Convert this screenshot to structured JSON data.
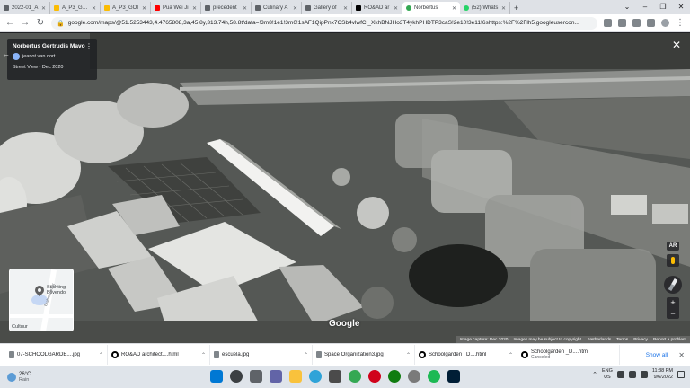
{
  "browser": {
    "tabs": [
      {
        "label": "2022-01_A",
        "active": false
      },
      {
        "label": "A_P3_GAR",
        "active": false
      },
      {
        "label": "A_P3_GOI",
        "active": false
      },
      {
        "label": "Pua Wei Ji",
        "active": false
      },
      {
        "label": "precedent",
        "active": false
      },
      {
        "label": "Culinary A",
        "active": false
      },
      {
        "label": "Gallery of",
        "active": false
      },
      {
        "label": "RO&AD ar",
        "active": false
      },
      {
        "label": "Norbertus",
        "active": true
      },
      {
        "label": "(52) Whats",
        "active": false
      }
    ],
    "new_tab": "+",
    "url": "google.com/maps/@51.5253443,4.4765808,3a,45.8y,313.74h,58.8t/data=!3m8!1e1!3m6!1sAF1QipPnx7CSb4vlwfCI_XkhBNJHo3T4ykhPHDTP3caS!2e10!3e11!6shttps:%2F%2Flh5.googleusercon..."
  },
  "street_view": {
    "place_title": "Norbertus Gertrudis Mavo",
    "author": "jeanot van dort",
    "date": "Street View - Dec 2020",
    "ar_label": "AR",
    "zoom_in": "+",
    "zoom_out": "−",
    "watermark": "Google",
    "footer": {
      "capture": "Image capture: Dec 2020",
      "copyright": "Images may be subject to copyright.",
      "netherlands": "Netherlands",
      "terms": "Terms",
      "privacy": "Privacy",
      "report": "Report a problem"
    }
  },
  "minimap": {
    "place_line1": "Stichting",
    "place_line2": "Blivendo",
    "street": "Brahmsstraat",
    "area": "Cultuur"
  },
  "downloads": {
    "items": [
      {
        "name": "07-SCHOOLGARDE....jpg",
        "status": "",
        "icon": "file"
      },
      {
        "name": "RO&AD architect....html",
        "status": "",
        "icon": "opera"
      },
      {
        "name": "escuela.jpg",
        "status": "",
        "icon": "file"
      },
      {
        "name": "Space Organization3.jpg",
        "status": "",
        "icon": "file"
      },
      {
        "name": "Schoolgarden _D....html",
        "status": "",
        "icon": "opera"
      },
      {
        "name": "Schoolgarden _D....html",
        "status": "Canceled",
        "icon": "opera"
      }
    ],
    "show_all": "Show all"
  },
  "taskbar": {
    "temperature": "26°C",
    "condition": "Rain",
    "language_line1": "ENG",
    "language_line2": "US",
    "time": "11:38 PM",
    "date": "9/6/2022"
  },
  "colors": {
    "tab_bg": "#dee1e6",
    "taskbar_bg": "#dfe4ea",
    "link_blue": "#1a73e8"
  }
}
